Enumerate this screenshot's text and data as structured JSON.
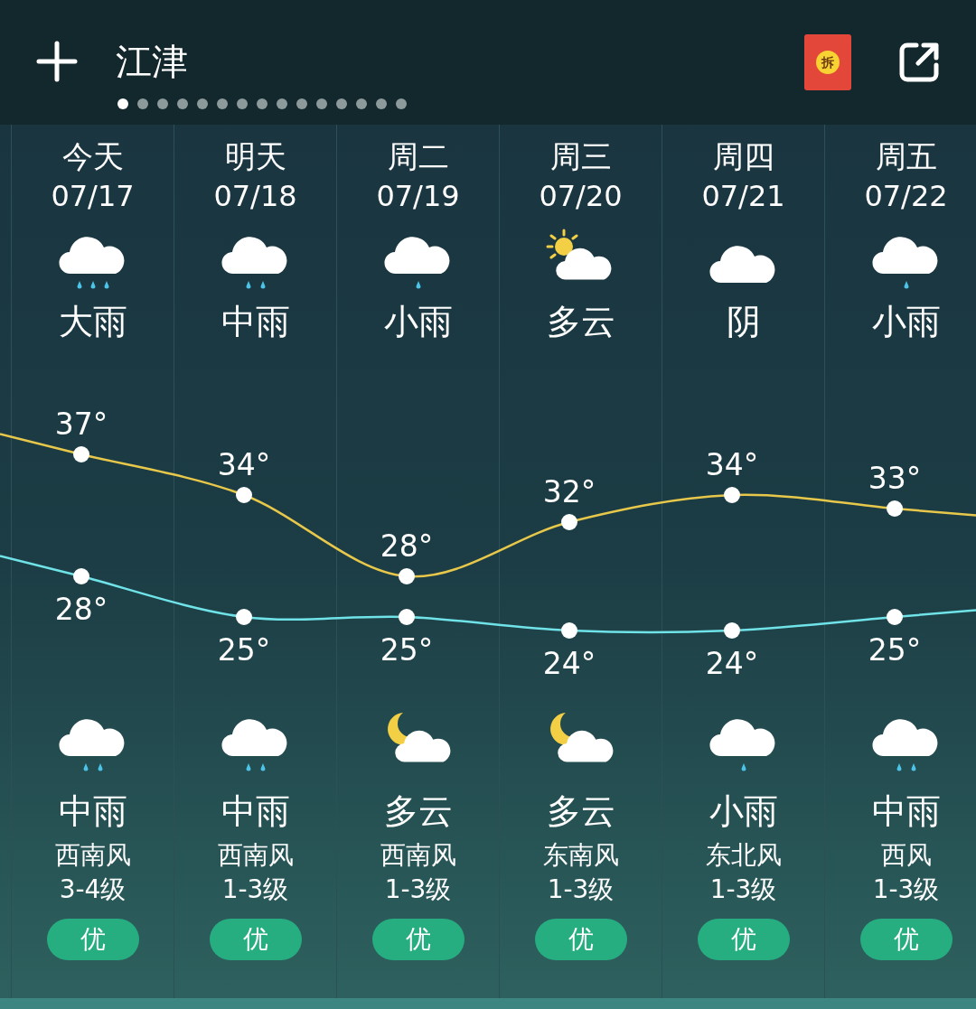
{
  "header": {
    "title": "江津",
    "envelope_label": "拆",
    "pages": [
      {
        "selected": true
      },
      {
        "selected": false
      },
      {
        "selected": false
      },
      {
        "selected": false
      },
      {
        "selected": false
      },
      {
        "selected": false
      },
      {
        "selected": false
      },
      {
        "selected": false
      },
      {
        "selected": false
      },
      {
        "selected": false
      },
      {
        "selected": false
      },
      {
        "selected": false
      },
      {
        "selected": false
      },
      {
        "selected": false
      },
      {
        "selected": false
      }
    ]
  },
  "days": [
    {
      "day": "今天",
      "date": "07/17",
      "daytime": {
        "kind": "heavy_rain",
        "condition": "大雨"
      },
      "high": "37°",
      "low": "28°",
      "night": {
        "kind": "moderate_rain",
        "condition": "中雨"
      },
      "wind": "西南风",
      "wind_level": "3-4级",
      "aqi": "优"
    },
    {
      "day": "明天",
      "date": "07/18",
      "daytime": {
        "kind": "moderate_rain",
        "condition": "中雨"
      },
      "high": "34°",
      "low": "25°",
      "night": {
        "kind": "moderate_rain",
        "condition": "中雨"
      },
      "wind": "西南风",
      "wind_level": "1-3级",
      "aqi": "优"
    },
    {
      "day": "周二",
      "date": "07/19",
      "daytime": {
        "kind": "light_rain",
        "condition": "小雨"
      },
      "high": "28°",
      "low": "25°",
      "night": {
        "kind": "partly_cloudy_night",
        "condition": "多云"
      },
      "wind": "西南风",
      "wind_level": "1-3级",
      "aqi": "优"
    },
    {
      "day": "周三",
      "date": "07/20",
      "daytime": {
        "kind": "partly_cloudy",
        "condition": "多云"
      },
      "high": "32°",
      "low": "24°",
      "night": {
        "kind": "partly_cloudy_night",
        "condition": "多云"
      },
      "wind": "东南风",
      "wind_level": "1-3级",
      "aqi": "优"
    },
    {
      "day": "周四",
      "date": "07/21",
      "daytime": {
        "kind": "overcast",
        "condition": "阴"
      },
      "high": "34°",
      "low": "24°",
      "night": {
        "kind": "light_rain",
        "condition": "小雨"
      },
      "wind": "东北风",
      "wind_level": "1-3级",
      "aqi": "优"
    },
    {
      "day": "周五",
      "date": "07/22",
      "daytime": {
        "kind": "light_rain",
        "condition": "小雨"
      },
      "high": "33°",
      "low": "25°",
      "night": {
        "kind": "moderate_rain",
        "condition": "中雨"
      },
      "wind": "西风",
      "wind_level": "1-3级",
      "aqi": "优"
    }
  ]
}
